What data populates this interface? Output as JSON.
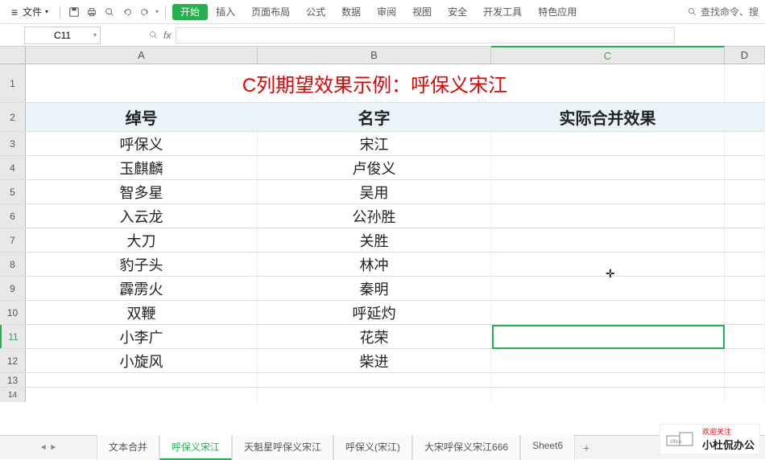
{
  "menubar": {
    "file": "文件",
    "tabs": [
      "开始",
      "插入",
      "页面布局",
      "公式",
      "数据",
      "审阅",
      "视图",
      "安全",
      "开发工具",
      "特色应用"
    ],
    "active_tab_index": 0,
    "search": "查找命令、搜"
  },
  "formula": {
    "name_box": "C11",
    "fx": "fx",
    "value": ""
  },
  "columns": [
    "A",
    "B",
    "C",
    "D"
  ],
  "title_row": "C列期望效果示例：呼保义宋江",
  "headers": {
    "A": "绰号",
    "B": "名字",
    "C": "实际合并效果"
  },
  "rows": [
    {
      "n": 3,
      "A": "呼保义",
      "B": "宋江",
      "C": ""
    },
    {
      "n": 4,
      "A": "玉麒麟",
      "B": "卢俊义",
      "C": ""
    },
    {
      "n": 5,
      "A": "智多星",
      "B": "吴用",
      "C": ""
    },
    {
      "n": 6,
      "A": "入云龙",
      "B": "公孙胜",
      "C": ""
    },
    {
      "n": 7,
      "A": "大刀",
      "B": "关胜",
      "C": ""
    },
    {
      "n": 8,
      "A": "豹子头",
      "B": "林冲",
      "C": ""
    },
    {
      "n": 9,
      "A": "霹雳火",
      "B": "秦明",
      "C": ""
    },
    {
      "n": 10,
      "A": "双鞭",
      "B": "呼延灼",
      "C": ""
    },
    {
      "n": 11,
      "A": "小李广",
      "B": "花荣",
      "C": ""
    },
    {
      "n": 12,
      "A": "小旋风",
      "B": "柴进",
      "C": ""
    }
  ],
  "extra_rows": [
    13,
    14
  ],
  "selected": {
    "row": 11,
    "col": "C"
  },
  "sheets": {
    "tabs": [
      "文本合并",
      "呼保义宋江",
      "天魁星呼保义宋江",
      "呼保义(宋江)",
      "大宋呼保义宋江666",
      "Sheet6"
    ],
    "active_index": 1
  },
  "watermark": {
    "line1": "欢迎关注",
    "line2": "小杜侃办公"
  }
}
